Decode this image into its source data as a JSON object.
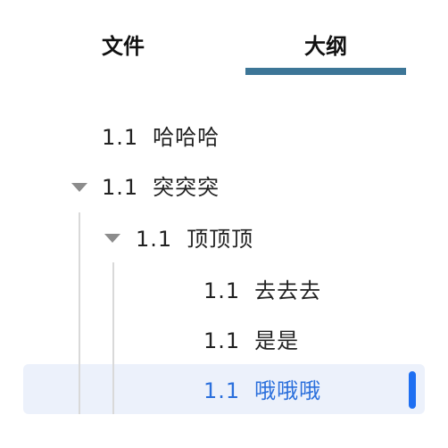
{
  "tabs": [
    {
      "label": "文件",
      "active": false
    },
    {
      "label": "大纲",
      "active": true
    }
  ],
  "accent_color": "#3d7697",
  "selection_color": "#1e6ff2",
  "outline": [
    {
      "number": "1.1",
      "text": "哈哈哈",
      "level": 0,
      "expanded": null
    },
    {
      "number": "1.1",
      "text": "突突突",
      "level": 0,
      "expanded": true
    },
    {
      "number": "1.1",
      "text": "顶顶顶",
      "level": 1,
      "expanded": true
    },
    {
      "number": "1.1",
      "text": "去去去",
      "level": 2,
      "expanded": null
    },
    {
      "number": "1.1",
      "text": "是是",
      "level": 2,
      "expanded": null
    },
    {
      "number": "1.1",
      "text": "哦哦哦",
      "level": 2,
      "expanded": null,
      "selected": true
    }
  ]
}
